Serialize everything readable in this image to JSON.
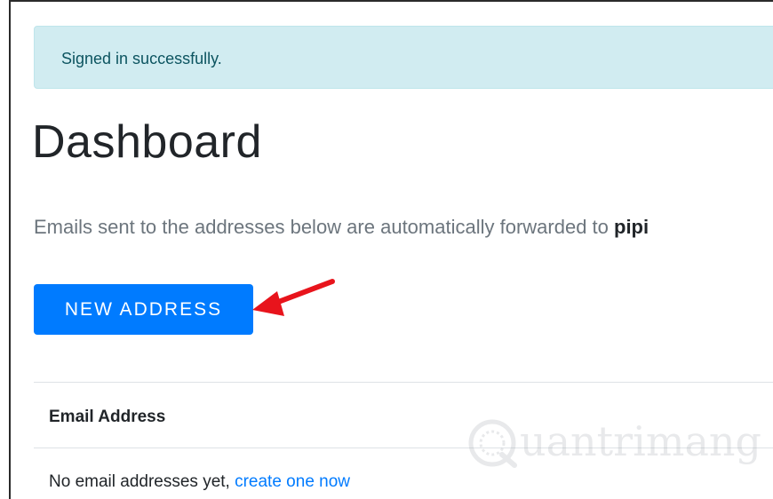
{
  "alert": {
    "message": "Signed in successfully.",
    "colors": {
      "background": "#d1ecf1",
      "border": "#bee5eb",
      "text": "#0c5460"
    }
  },
  "page": {
    "title": "Dashboard",
    "lead_text": "Emails sent to the addresses below are automatically forwarded to ",
    "lead_emphasis": "pipi"
  },
  "actions": {
    "new_address_label": "NEW ADDRESS",
    "accent_color": "#007bff",
    "annotation": "red-arrow-pointing-left"
  },
  "table": {
    "columns": [
      "Email Address"
    ],
    "empty_text": "No email addresses yet, ",
    "empty_link": "create one now"
  },
  "watermark": {
    "text": "uantrimang",
    "icon": "q-logo-icon"
  }
}
